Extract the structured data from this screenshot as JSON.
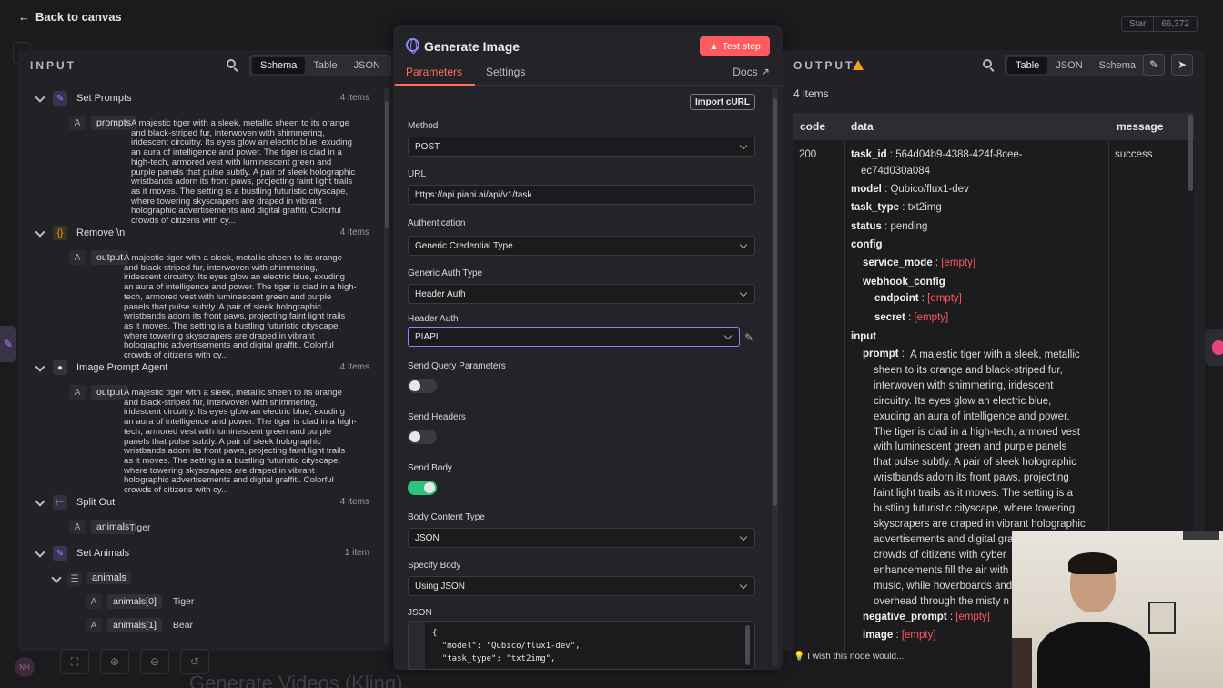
{
  "top": {
    "back": "Back to canvas",
    "star_label": "Star",
    "star_count": "66,372"
  },
  "input_panel": {
    "title": "INPUT",
    "view_tabs": [
      "Schema",
      "Table",
      "JSON"
    ],
    "nodes": [
      {
        "name": "Set Prompts",
        "count": "4 items",
        "field": "prompts",
        "type": "A",
        "lines": [
          "A majestic tiger with a sleek, metallic sheen to its orange",
          "and black-striped fur, interwoven with shimmering,",
          "iridescent circuitry. Its eyes glow an electric blue, exuding",
          "an aura of intelligence and power. The tiger is clad in a",
          "high-tech, armored vest with luminescent green and",
          "purple panels that pulse subtly. A pair of sleek holographic",
          "wristbands adorn its front paws, projecting faint light trails",
          "as it moves. The setting is a bustling futuristic cityscape,",
          "where towering skyscrapers are draped in vibrant",
          "holographic advertisements and digital graffiti. Colorful",
          "crowds of citizens with cy..."
        ]
      },
      {
        "name": "Remove \\n",
        "count": "4 items",
        "field": "output",
        "type": "A",
        "lines": [
          "A majestic tiger with a sleek, metallic sheen to its orange",
          "and black-striped fur, interwoven with shimmering,",
          "iridescent circuitry. Its eyes glow an electric blue, exuding",
          "an aura of intelligence and power. The tiger is clad in a high-",
          "tech, armored vest with luminescent green and purple",
          "panels that pulse subtly. A pair of sleek holographic",
          "wristbands adorn its front paws, projecting faint light trails",
          "as it moves. The setting is a bustling futuristic cityscape,",
          "where towering skyscrapers are draped in vibrant",
          "holographic advertisements and digital graffiti. Colorful",
          "crowds of citizens with cy..."
        ]
      },
      {
        "name": "Image Prompt Agent",
        "count": "4 items",
        "field": "output",
        "type": "A",
        "lines": [
          "A majestic tiger with a sleek, metallic sheen to its orange",
          "and black-striped fur, interwoven with shimmering,",
          "iridescent circuitry. Its eyes glow an electric blue, exuding",
          "an aura of intelligence and power. The tiger is clad in a high-",
          "tech, armored vest with luminescent green and purple",
          "panels that pulse subtly. A pair of sleek holographic",
          "wristbands adorn its front paws, projecting faint light trails",
          "as it moves. The setting is a bustling futuristic cityscape,",
          "where towering skyscrapers are draped in vibrant",
          "holographic advertisements and digital graffiti. Colorful",
          "crowds of citizens with cy..."
        ]
      },
      {
        "name": "Split Out",
        "count": "4 items",
        "field": "animals",
        "type": "A",
        "value": "Tiger"
      },
      {
        "name": "Set Animals",
        "count": "1 item",
        "field": "animals",
        "type": "list",
        "children": [
          {
            "key": "animals[0]",
            "value": "Tiger"
          },
          {
            "key": "animals[1]",
            "value": "Bear"
          }
        ]
      }
    ]
  },
  "ghost_title": "Generate Videos (Kling)",
  "modal": {
    "title": "Generate Image",
    "test_step": "Test step",
    "tabs": [
      "Parameters",
      "Settings"
    ],
    "docs": "Docs",
    "import_curl": "Import cURL",
    "method_label": "Method",
    "method_value": "POST",
    "url_label": "URL",
    "url_value": "https://api.piapi.ai/api/v1/task",
    "auth_label": "Authentication",
    "auth_value": "Generic Credential Type",
    "generic_auth_label": "Generic Auth Type",
    "generic_auth_value": "Header Auth",
    "header_auth_label": "Header Auth",
    "header_auth_value": "PIAPI",
    "send_query_label": "Send Query Parameters",
    "send_query_on": false,
    "send_headers_label": "Send Headers",
    "send_headers_on": false,
    "send_body_label": "Send Body",
    "send_body_on": true,
    "body_type_label": "Body Content Type",
    "body_type_value": "JSON",
    "specify_body_label": "Specify Body",
    "specify_body_value": "Using JSON",
    "json_label": "JSON",
    "json_lines": [
      "{",
      "  \"model\": \"Qubico/flux1-dev\",",
      "  \"task_type\": \"txt2img\","
    ]
  },
  "output_panel": {
    "title": "OUTPUT",
    "view_tabs": [
      "Table",
      "JSON",
      "Schema"
    ],
    "items_count": "4 items",
    "columns": [
      "code",
      "data",
      "message"
    ],
    "row": {
      "code": "200",
      "message": "success",
      "task_id_key": "task_id",
      "task_id_1": "564d04b9-4388-424f-8cee-",
      "task_id_2": "ec74d030a084",
      "model_key": "model",
      "model_value": "Qubico/flux1-dev",
      "task_type_key": "task_type",
      "task_type_value": "txt2img",
      "status_key": "status",
      "status_value": "pending",
      "config_key": "config",
      "service_mode_key": "service_mode",
      "empty": "[empty]",
      "webhook_key": "webhook_config",
      "endpoint_key": "endpoint",
      "secret_key": "secret",
      "input_key": "input",
      "prompt_key": "prompt",
      "prompt_lines": [
        "A majestic tiger with a sleek, metallic",
        "sheen to its orange and black-striped fur,",
        "interwoven with shimmering, iridescent",
        "circuitry. Its eyes glow an electric blue,",
        "exuding an aura of intelligence and power.",
        "The tiger is clad in a high-tech, armored vest",
        "with luminescent green and purple panels",
        "that pulse subtly. A pair of sleek holographic",
        "wristbands adorn its front paws, projecting",
        "faint light trails as it moves. The setting is a",
        "bustling futuristic cityscape, where towering",
        "skyscrapers are draped in vibrant holographic",
        "advertisements and digital gra",
        "crowds of citizens with cyber",
        "enhancements fill the air with",
        "music, while hoverboards and",
        "overhead through the misty n"
      ],
      "negative_prompt_key": "negative_prompt",
      "image_key": "image"
    },
    "wish": "I wish this node would..."
  }
}
